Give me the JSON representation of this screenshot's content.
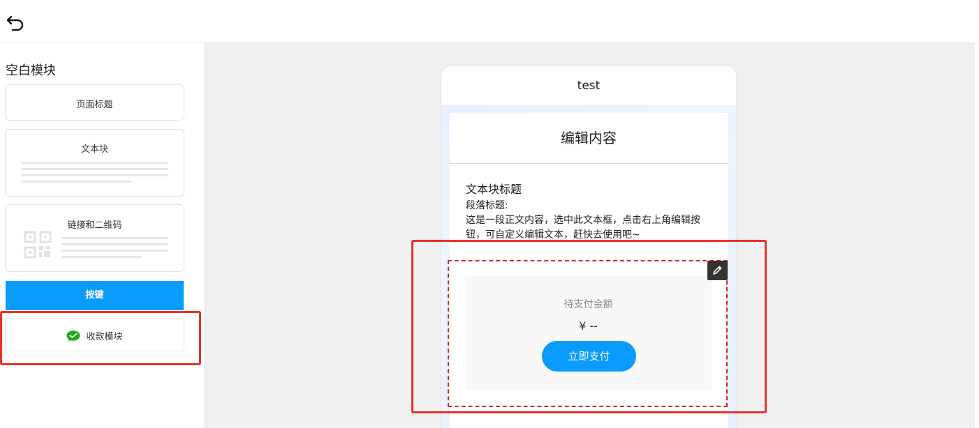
{
  "topbar": {
    "back_icon": "undo-arrow-icon"
  },
  "sidebar": {
    "title": "空白模块",
    "items": [
      {
        "label": "页面标题"
      },
      {
        "label": "文本块"
      },
      {
        "label": "链接和二维码"
      },
      {
        "label": "按键"
      },
      {
        "label": "收款模块",
        "icon": "wechat-pay-icon"
      }
    ]
  },
  "phone": {
    "header_title": "test",
    "content_title": "编辑内容",
    "text_block": {
      "title": "文本块标题",
      "paragraph_title": "段落标题:",
      "body": "这是一段正文内容，选中此文本框，点击右上角编辑按钮，可自定义编辑文本，赶快去使用吧~"
    },
    "payment": {
      "amount_label": "待支付金额",
      "amount": "¥ --",
      "pay_button": "立即支付"
    },
    "edit_icon": "pencil-icon"
  },
  "colors": {
    "accent": "#0a9bff",
    "highlight": "#e8312a",
    "wechat_green": "#1aad19"
  }
}
